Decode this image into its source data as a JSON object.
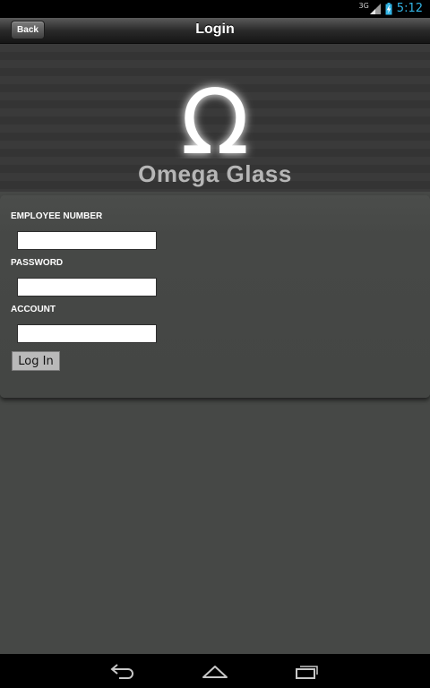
{
  "status_bar": {
    "network": "3G",
    "time": "5:12"
  },
  "nav": {
    "back_label": "Back",
    "title": "Login"
  },
  "logo": {
    "symbol": "Ω",
    "brand_name": "Omega Glass"
  },
  "form": {
    "employee_number": {
      "label": "EMPLOYEE NUMBER",
      "value": "",
      "placeholder": ""
    },
    "password": {
      "label": "PASSWORD",
      "value": "",
      "placeholder": ""
    },
    "account": {
      "label": "ACCOUNT",
      "value": "",
      "placeholder": ""
    },
    "submit_label": "Log In"
  },
  "system_nav": {
    "icons": [
      "back-arrow-icon",
      "home-icon",
      "recent-apps-icon"
    ]
  },
  "colors": {
    "background": "#464846",
    "status_time": "#33b5e5",
    "logo_symbol": "#ffffff",
    "logo_text": "#b6b6b6"
  }
}
